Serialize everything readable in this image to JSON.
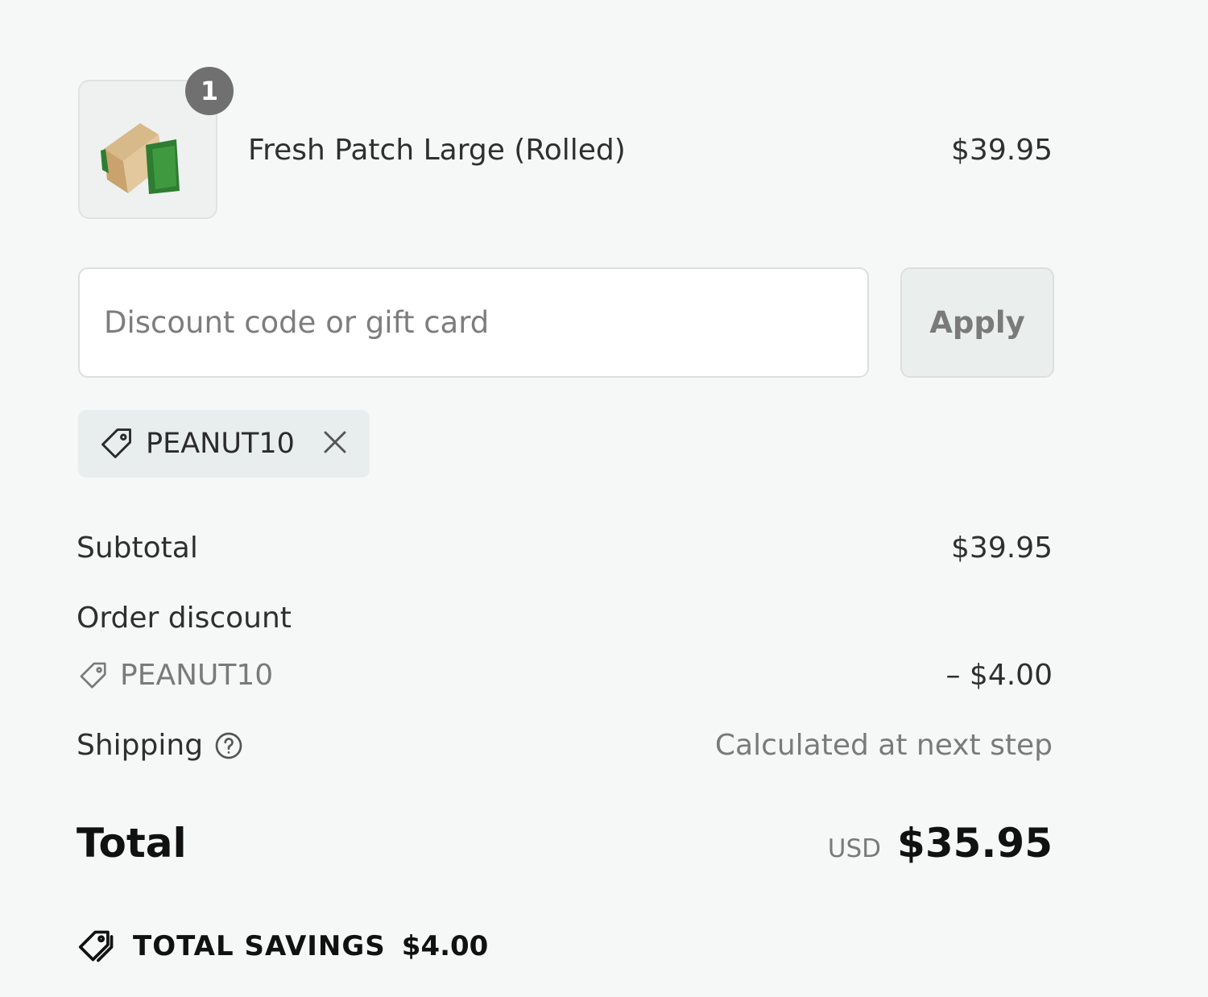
{
  "line_item": {
    "quantity": "1",
    "name": "Fresh Patch Large (Rolled)",
    "price": "$39.95",
    "image_icon": "product-box-icon"
  },
  "discount": {
    "placeholder": "Discount code or gift card",
    "value": "",
    "apply_label": "Apply",
    "applied_code": "PEANUT10",
    "tag_icon": "tag-icon",
    "remove_icon": "close-icon"
  },
  "totals": {
    "subtotal_label": "Subtotal",
    "subtotal_value": "$39.95",
    "order_discount_label": "Order discount",
    "order_discount_code": "PEANUT10",
    "order_discount_value": "– $4.00",
    "shipping_label": "Shipping",
    "shipping_value": "Calculated at next step",
    "total_label": "Total",
    "currency": "USD",
    "total_value": "$35.95"
  },
  "savings": {
    "label": "TOTAL SAVINGS",
    "amount": "$4.00",
    "icon": "tags-icon"
  },
  "colors": {
    "background": "#f6f8f7",
    "badge": "#707070",
    "chip": "#e8eeed",
    "muted_text": "#7a7a7a"
  }
}
